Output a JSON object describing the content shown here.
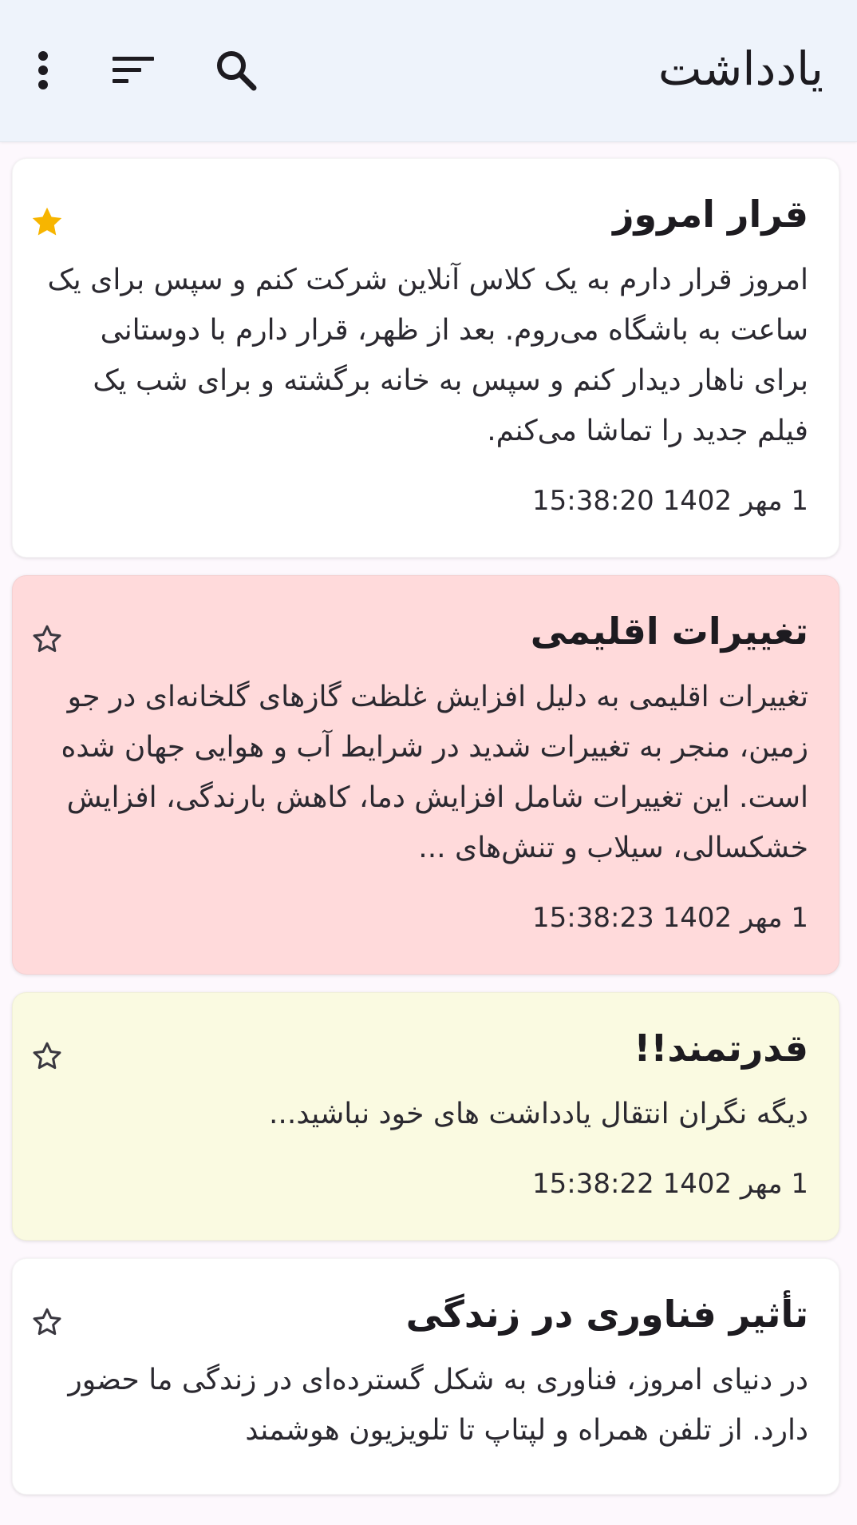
{
  "app_bar": {
    "title": "یادداشت",
    "icons": [
      "search-icon",
      "sort-icon",
      "more-vert-icon"
    ]
  },
  "colors": {
    "app_bar_bg": "#eef3fb",
    "card_white": "#ffffff",
    "card_pink": "#ffdadb",
    "card_yellow": "#fafae1",
    "star_filled": "#f7b500"
  },
  "notes": [
    {
      "title": "قرار امروز",
      "body": "امروز قرار دارم به یک کلاس آنلاین شرکت کنم و سپس برای یک ساعت به باشگاه می‌روم. بعد از ظهر، قرار دارم با دوستانی برای ناهار دیدار کنم و سپس به خانه برگشته و برای شب یک فیلم جدید را تماشا می‌کنم.",
      "date": "1 مهر 1402 15:38:20",
      "starred": true,
      "bg": "#ffffff"
    },
    {
      "title": "تغییرات اقلیمی",
      "body": "تغییرات اقلیمی به دلیل افزایش غلظت گازهای گلخانه‌ای در جو زمین، منجر به تغییرات شدید در شرایط آب و هوایی جهان شده است. این تغییرات شامل افزایش دما، کاهش بارندگی، افزایش خشکسالی، سیلاب و تنش‌های ...",
      "date": "1 مهر 1402 15:38:23",
      "starred": false,
      "bg": "#ffdadb"
    },
    {
      "title": "قدرتمند!!",
      "body": "دیگه نگران انتقال یادداشت های خود نباشید...",
      "date": "1 مهر 1402 15:38:22",
      "starred": false,
      "bg": "#fafae1"
    },
    {
      "title": "تأثیر فناوری در زندگی",
      "body": "در دنیای امروز، فناوری به شکل گسترده‌ای در زندگی ما حضور دارد. از تلفن همراه و لپتاپ تا تلویزیون هوشمند",
      "date": "",
      "starred": false,
      "bg": "#ffffff"
    }
  ]
}
